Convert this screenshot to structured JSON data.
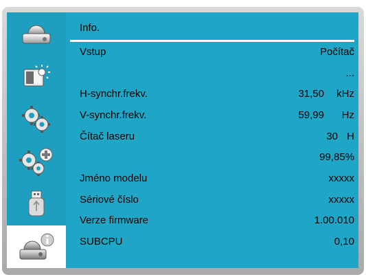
{
  "colors": {
    "sidebar": "#1f9fbf",
    "content": "#1fa5c6",
    "frame": "#c8c8c8"
  },
  "sidebar": {
    "items": [
      {
        "icon": "projector-icon",
        "active": false
      },
      {
        "icon": "brightness-icon",
        "active": false
      },
      {
        "icon": "gears-icon",
        "active": false
      },
      {
        "icon": "gears-plus-icon",
        "active": false
      },
      {
        "icon": "usb-icon",
        "active": false
      },
      {
        "icon": "projector-info-icon",
        "active": true
      }
    ]
  },
  "panel": {
    "title": "Info.",
    "rows": [
      {
        "label": "Vstup",
        "value": "Počítač"
      },
      {
        "label": "",
        "value": "..."
      },
      {
        "label": "H-synchr.frekv.",
        "value": "31,50",
        "unit": "kHz"
      },
      {
        "label": "V-synchr.frekv.",
        "value": "59,99",
        "unit": "Hz"
      },
      {
        "label": "Čítač laseru",
        "value": "30",
        "unit": "H"
      },
      {
        "label": "",
        "value": "99,85%"
      },
      {
        "label": "Jméno modelu",
        "value": "xxxxx"
      },
      {
        "label": "Sériové číslo",
        "value": "xxxxx"
      },
      {
        "label": "Verze firmware",
        "value": "1.00.010"
      },
      {
        "label": "SUBCPU",
        "value": "0,10"
      }
    ]
  }
}
